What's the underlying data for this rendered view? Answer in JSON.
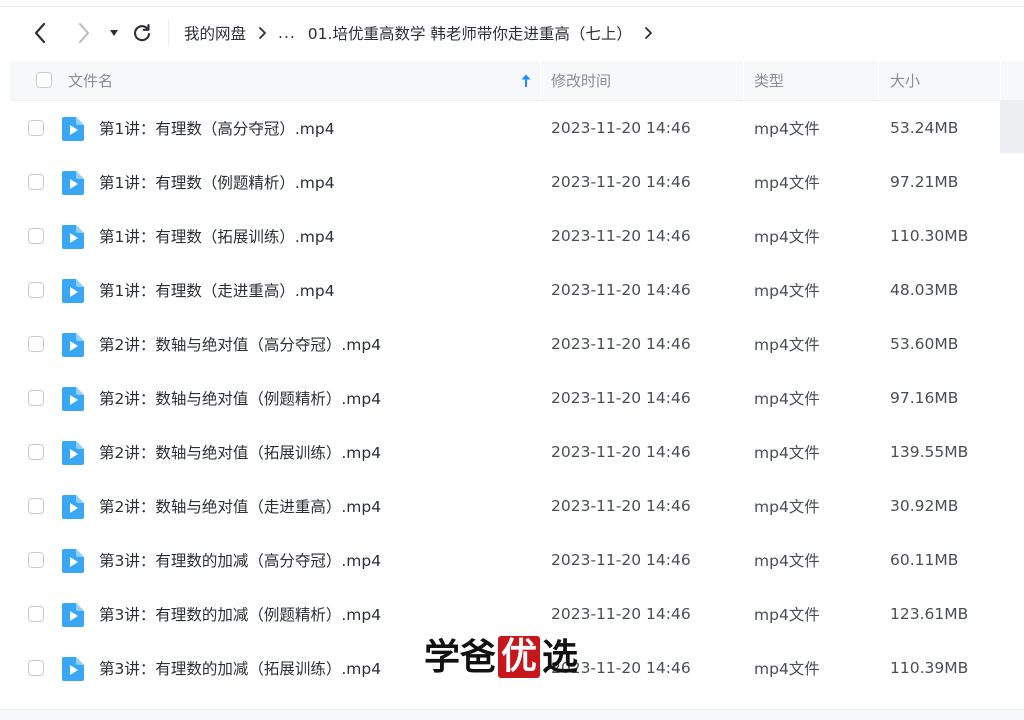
{
  "nav": {
    "back_icon": "chevron-left-icon",
    "forward_icon": "chevron-right-icon",
    "history_icon": "caret-down-icon",
    "refresh_icon": "refresh-icon"
  },
  "breadcrumb": {
    "root": "我的网盘",
    "ellipsis": "...",
    "current": "01.培优重高数学 韩老师带你走进重高（七上）"
  },
  "table": {
    "headers": {
      "name": "文件名",
      "time": "修改时间",
      "type": "类型",
      "size": "大小"
    },
    "sort_icon": "sort-ascending-icon",
    "rows": [
      {
        "name": "第1讲：有理数（高分夺冠）.mp4",
        "time": "2023-11-20 14:46",
        "type": "mp4文件",
        "size": "53.24MB"
      },
      {
        "name": "第1讲：有理数（例题精析）.mp4",
        "time": "2023-11-20 14:46",
        "type": "mp4文件",
        "size": "97.21MB"
      },
      {
        "name": "第1讲：有理数（拓展训练）.mp4",
        "time": "2023-11-20 14:46",
        "type": "mp4文件",
        "size": "110.30MB"
      },
      {
        "name": "第1讲：有理数（走进重高）.mp4",
        "time": "2023-11-20 14:46",
        "type": "mp4文件",
        "size": "48.03MB"
      },
      {
        "name": "第2讲：数轴与绝对值（高分夺冠）.mp4",
        "time": "2023-11-20 14:46",
        "type": "mp4文件",
        "size": "53.60MB"
      },
      {
        "name": "第2讲：数轴与绝对值（例题精析）.mp4",
        "time": "2023-11-20 14:46",
        "type": "mp4文件",
        "size": "97.16MB"
      },
      {
        "name": "第2讲：数轴与绝对值（拓展训练）.mp4",
        "time": "2023-11-20 14:46",
        "type": "mp4文件",
        "size": "139.55MB"
      },
      {
        "name": "第2讲：数轴与绝对值（走进重高）.mp4",
        "time": "2023-11-20 14:46",
        "type": "mp4文件",
        "size": "30.92MB"
      },
      {
        "name": "第3讲：有理数的加减（高分夺冠）.mp4",
        "time": "2023-11-20 14:46",
        "type": "mp4文件",
        "size": "60.11MB"
      },
      {
        "name": "第3讲：有理数的加减（例题精析）.mp4",
        "time": "2023-11-20 14:46",
        "type": "mp4文件",
        "size": "123.61MB"
      },
      {
        "name": "第3讲：有理数的加减（拓展训练）.mp4",
        "time": "2023-11-20 14:46",
        "type": "mp4文件",
        "size": "110.39MB"
      }
    ]
  },
  "file_icon": "video-file-icon",
  "watermark": {
    "chars": [
      "学",
      "爸",
      "优",
      "选"
    ]
  },
  "colors": {
    "accent": "#1a8cff",
    "file_icon": "#3aa7f5",
    "watermark_red": "#c8161d"
  }
}
